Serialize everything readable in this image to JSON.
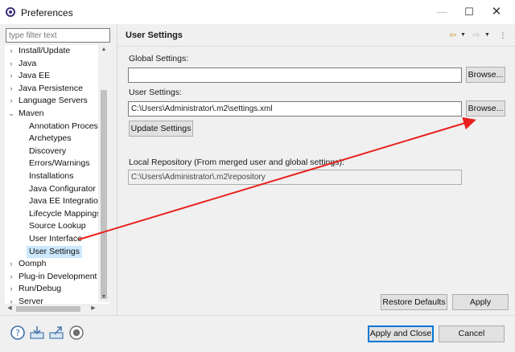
{
  "window": {
    "title": "Preferences",
    "minimize_glyph": "—",
    "maximize_glyph": "☐",
    "close_glyph": "✕"
  },
  "sidebar": {
    "filter_placeholder": "type filter text",
    "items": [
      {
        "label": "Install/Update",
        "expander": "›"
      },
      {
        "label": "Java",
        "expander": "›"
      },
      {
        "label": "Java EE",
        "expander": "›"
      },
      {
        "label": "Java Persistence",
        "expander": "›"
      },
      {
        "label": "Language Servers",
        "expander": "›"
      },
      {
        "label": "Maven",
        "expander": "⌄"
      },
      {
        "label": "Annotation Process"
      },
      {
        "label": "Archetypes"
      },
      {
        "label": "Discovery"
      },
      {
        "label": "Errors/Warnings"
      },
      {
        "label": "Installations"
      },
      {
        "label": "Java Configurator"
      },
      {
        "label": "Java EE Integration"
      },
      {
        "label": "Lifecycle Mappings"
      },
      {
        "label": "Source Lookup"
      },
      {
        "label": "User Interface"
      },
      {
        "label": "User Settings",
        "selected": true
      },
      {
        "label": "Oomph",
        "expander": "›"
      },
      {
        "label": "Plug-in Development",
        "expander": "›"
      },
      {
        "label": "Run/Debug",
        "expander": "›"
      },
      {
        "label": "Server",
        "expander": "›"
      }
    ]
  },
  "page": {
    "title": "User Settings",
    "global_settings_label": "Global Settings:",
    "global_settings_value": "",
    "browse_label": "Browse...",
    "user_settings_label": "User Settings:",
    "user_settings_value": "C:\\Users\\Administrator\\.m2\\settings.xml",
    "update_settings_label": "Update Settings",
    "local_repo_label": "Local Repository (From merged user and global settings):",
    "local_repo_value": "C:\\Users\\Administrator\\.m2\\repository",
    "restore_defaults_label": "Restore Defaults",
    "apply_label": "Apply"
  },
  "footer": {
    "apply_close_label": "Apply and Close",
    "cancel_label": "Cancel"
  },
  "colors": {
    "selection": "#cce8ff",
    "accent": "#0078d7",
    "annotation_arrow": "#e8211c"
  }
}
